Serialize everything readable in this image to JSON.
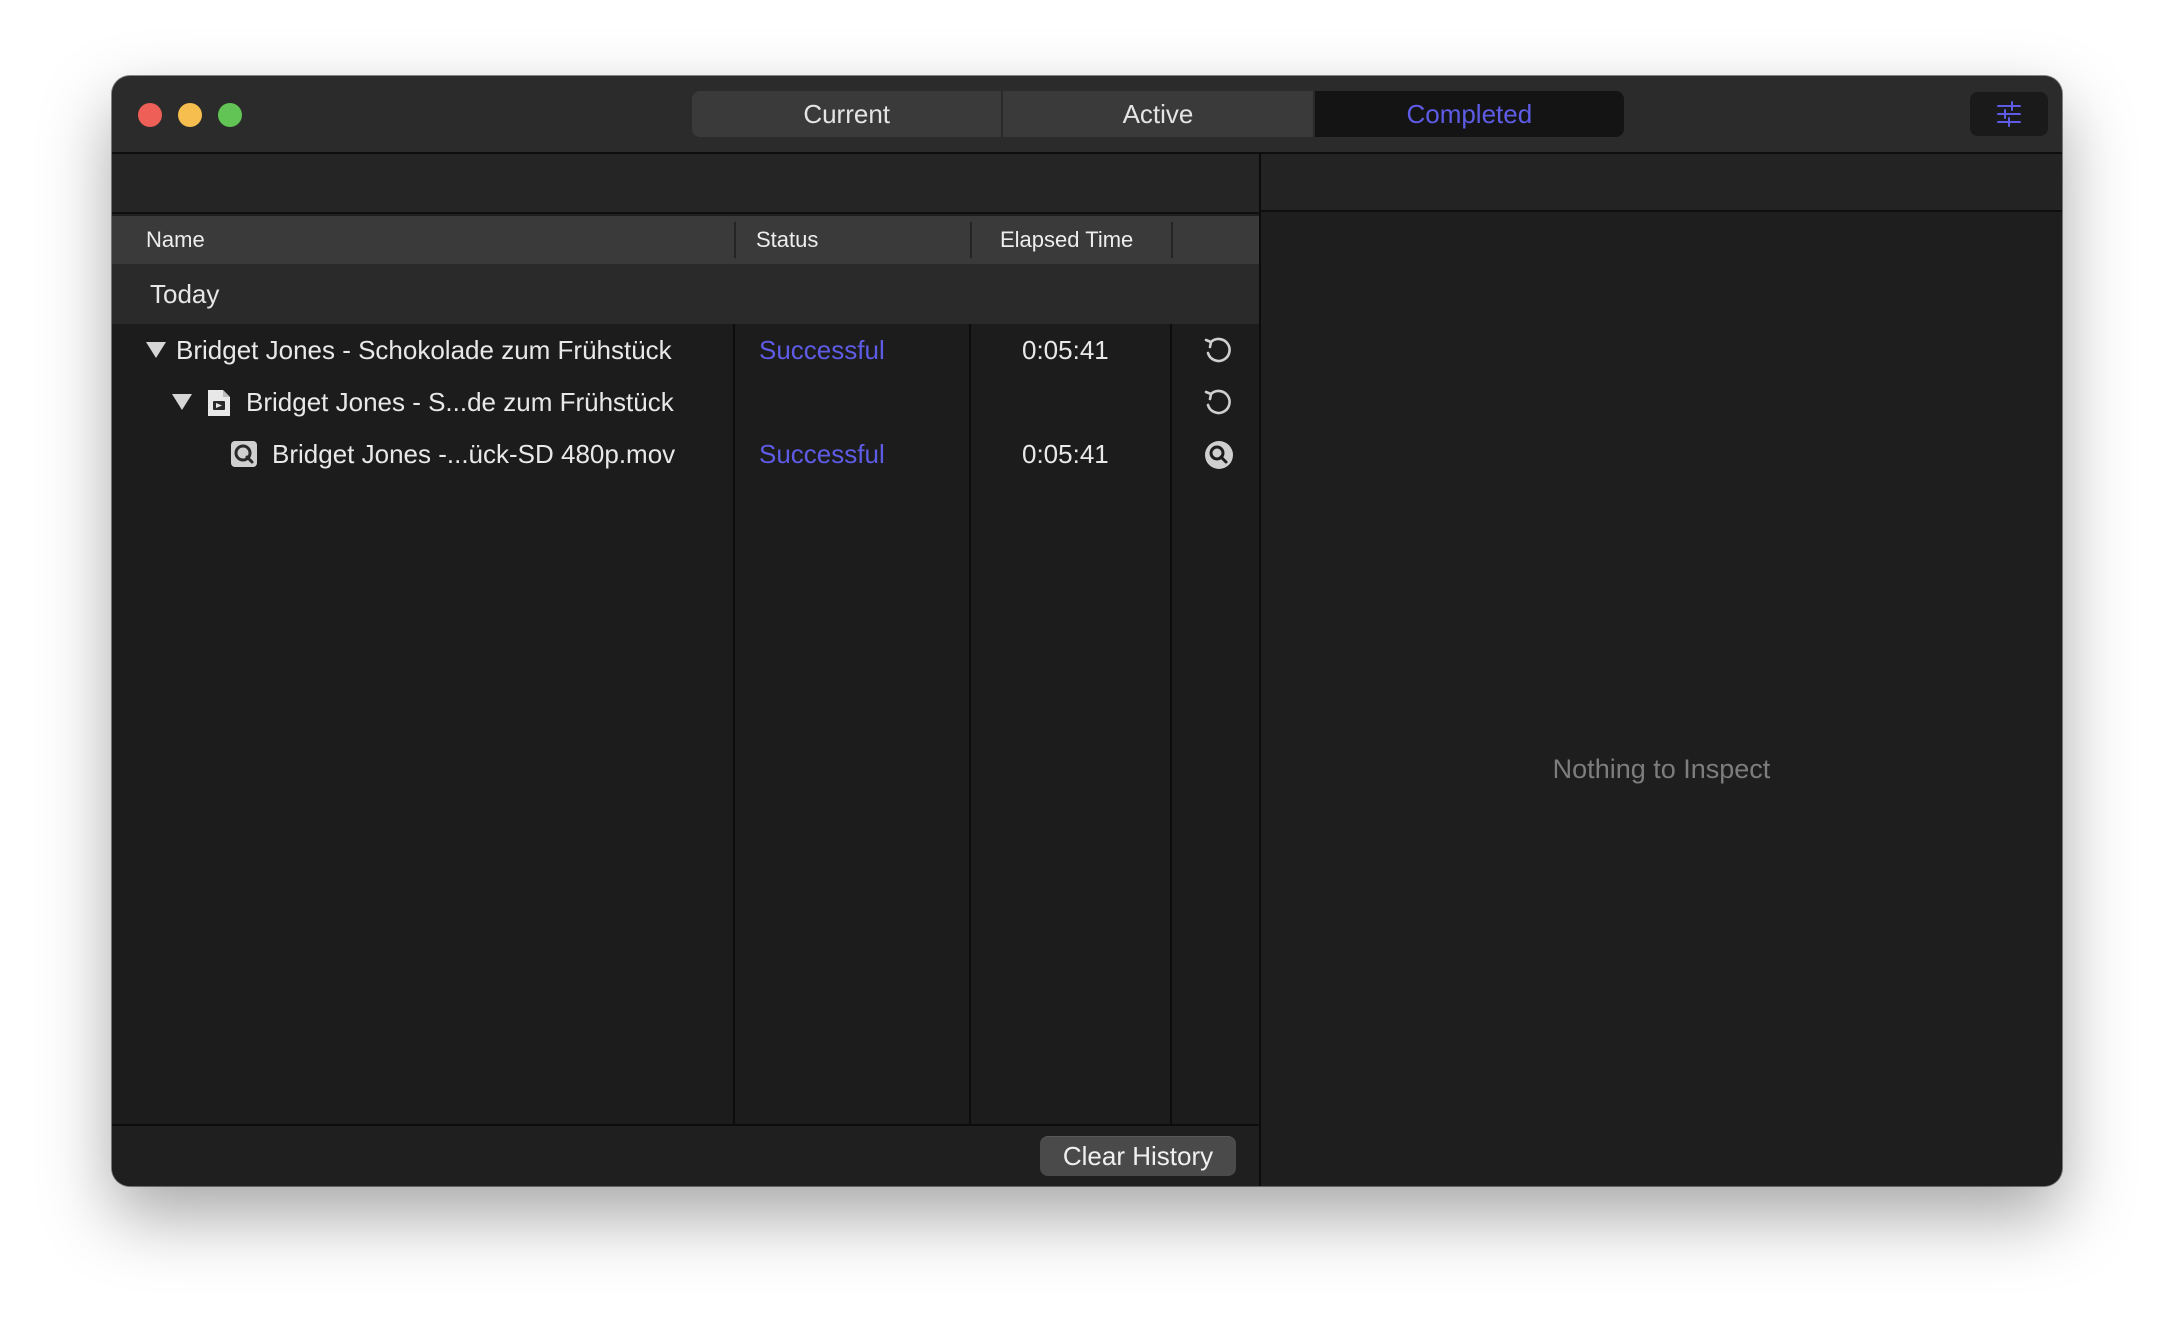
{
  "window": {
    "tabs": [
      {
        "label": "Current"
      },
      {
        "label": "Active"
      },
      {
        "label": "Completed"
      }
    ],
    "selected_tab": "Completed",
    "accent_color": "#5e5ce6"
  },
  "table": {
    "columns": [
      "Name",
      "Status",
      "Elapsed Time"
    ],
    "group_label": "Today",
    "rows": [
      {
        "name": "Bridget Jones - Schokolade zum Frühstück",
        "status": "Successful",
        "elapsed": "0:05:41",
        "action_icon": "retry-icon"
      },
      {
        "name": "Bridget Jones - S...de zum Frühstück",
        "status": "",
        "elapsed": "",
        "action_icon": "retry-icon"
      },
      {
        "name": "Bridget Jones -...ück-SD 480p.mov",
        "status": "Successful",
        "elapsed": "0:05:41",
        "action_icon": "magnifier-icon"
      }
    ]
  },
  "footer": {
    "clear_label": "Clear History"
  },
  "inspector": {
    "empty_text": "Nothing to Inspect"
  }
}
